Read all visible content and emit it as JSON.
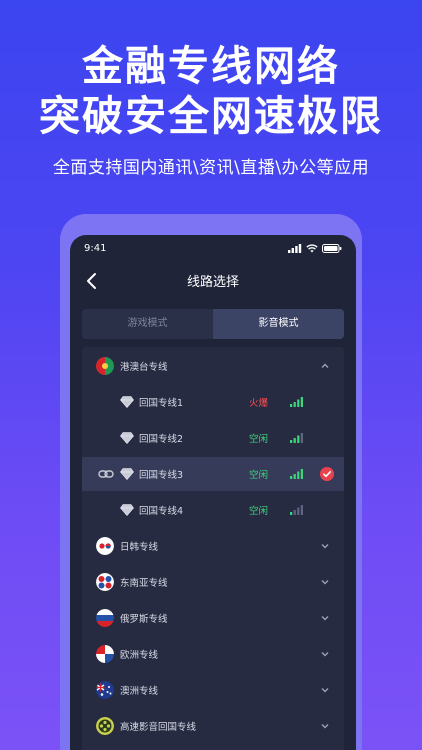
{
  "promo": {
    "title_line1": "金融专线网络",
    "title_line2": "突破安全网速极限",
    "subtitle": "全面支持国内通讯\\资讯\\直播\\办公等应用"
  },
  "status_bar": {
    "time": "9:41"
  },
  "nav": {
    "title": "线路选择"
  },
  "tabs": [
    {
      "label": "游戏模式",
      "active": false
    },
    {
      "label": "影音模式",
      "active": true
    }
  ],
  "regions": [
    {
      "label": "港澳台专线",
      "expanded": true,
      "flag_icon": "hk-macau-flag-icon",
      "lines": [
        {
          "label": "回国专线1",
          "status": "火爆",
          "status_color": "#ff4d4f",
          "selected": false
        },
        {
          "label": "回国专线2",
          "status": "空闲",
          "status_color": "#3ed67a",
          "selected": false
        },
        {
          "label": "回国专线3",
          "status": "空闲",
          "status_color": "#3ed67a",
          "selected": true
        },
        {
          "label": "回国专线4",
          "status": "空闲",
          "status_color": "#3ed67a",
          "selected": false
        }
      ]
    },
    {
      "label": "日韩专线",
      "expanded": false,
      "flag_icon": "japan-korea-flag-icon"
    },
    {
      "label": "东南亚专线",
      "expanded": false,
      "flag_icon": "southeast-asia-flag-icon"
    },
    {
      "label": "俄罗斯专线",
      "expanded": false,
      "flag_icon": "russia-flag-icon"
    },
    {
      "label": "欧洲专线",
      "expanded": false,
      "flag_icon": "europe-flag-icon"
    },
    {
      "label": "澳洲专线",
      "expanded": false,
      "flag_icon": "australia-flag-icon"
    },
    {
      "label": "高速影音回国专线",
      "expanded": false,
      "flag_icon": "film-reel-icon"
    }
  ],
  "colors": {
    "accent_red": "#e8414f",
    "idle_green": "#3ed67a",
    "busy_red": "#ff4d4f",
    "background_blue": "#4d45f2"
  }
}
